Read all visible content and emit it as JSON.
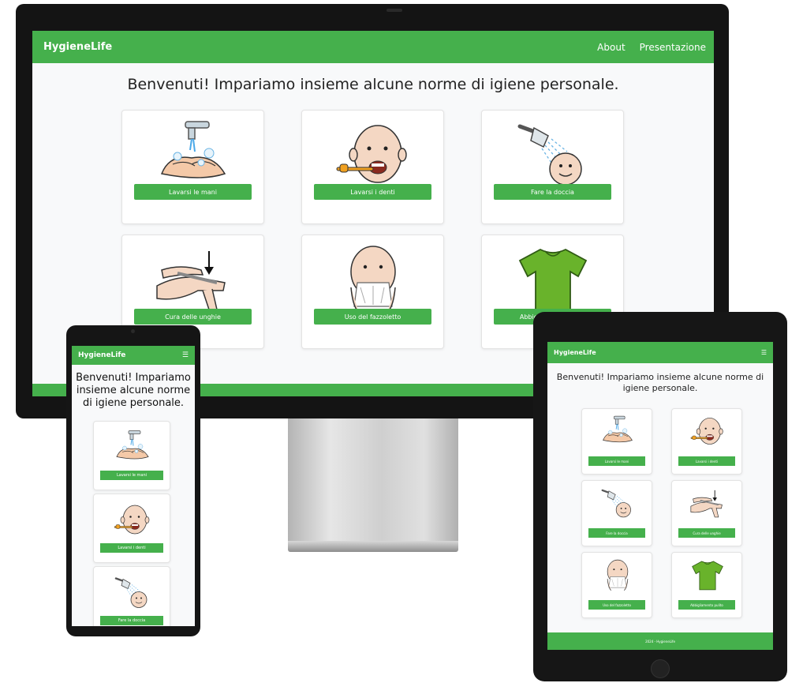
{
  "site": {
    "brand": "HygieneLife",
    "nav_links": [
      "About",
      "Presentazione"
    ],
    "menu_icon": "hamburger-icon",
    "welcome": "Benvenuti! Impariamo insieme alcune norme di igiene personale.",
    "footer": "2024 - HygieneLife"
  },
  "cards": [
    {
      "label": "Lavarsi le mani",
      "icon": "hand-washing-icon"
    },
    {
      "label": "Lavarsi i denti",
      "icon": "tooth-brushing-icon"
    },
    {
      "label": "Fare la doccia",
      "icon": "shower-icon"
    },
    {
      "label": "Cura delle unghie",
      "icon": "nail-clipper-icon"
    },
    {
      "label": "Uso del fazzoletto",
      "icon": "tissue-icon"
    },
    {
      "label": "Abbigliamento pulito",
      "icon": "tshirt-icon"
    }
  ],
  "colors": {
    "primary": "#45b04c",
    "page_bg": "#f8f9fa",
    "device_frame": "#151515",
    "shirt": "#69b32b"
  }
}
